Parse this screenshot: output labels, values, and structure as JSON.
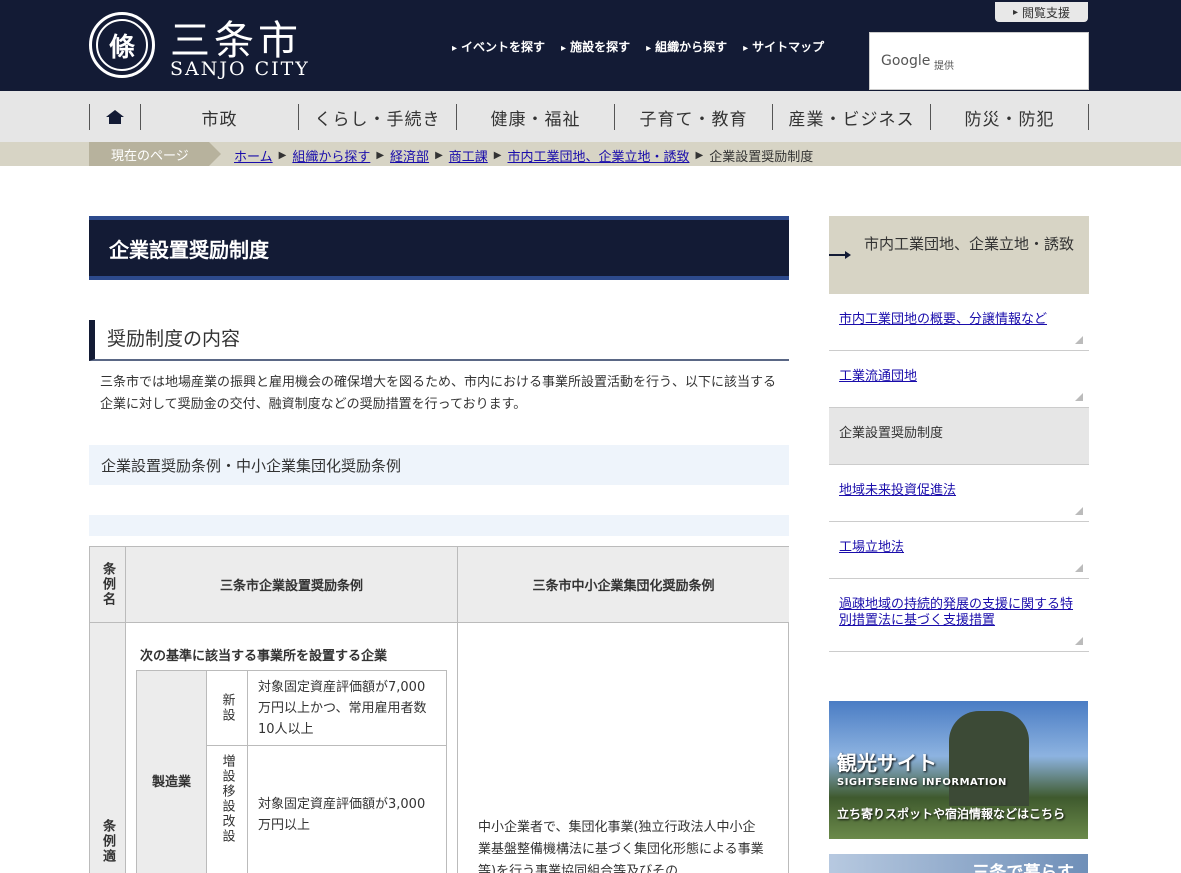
{
  "header": {
    "logo_symbol": "條",
    "logo_jp": "三条市",
    "logo_en": "SANJO CITY",
    "topnav": [
      "イベントを探す",
      "施設を探す",
      "組織から探す",
      "サイトマップ"
    ],
    "access_label": "閲覧支援",
    "search_brand": "Google",
    "search_provided": "提供"
  },
  "mainnav": [
    "市政",
    "くらし・手続き",
    "健康・福祉",
    "子育て・教育",
    "産業・ビジネス",
    "防災・防犯"
  ],
  "breadcrumb": {
    "label": "現在のページ",
    "links": [
      "ホーム",
      "組織から探す",
      "経済部",
      "商工課",
      "市内工業団地、企業立地・誘致"
    ],
    "current": "企業設置奨励制度"
  },
  "page_title": "企業設置奨励制度",
  "section": {
    "h2": "奨励制度の内容",
    "intro": "三条市では地場産業の振興と雇用機会の確保増大を図るため、市内における事業所設置活動を行う、以下に該当する企業に対して奨励金の交付、融資制度などの奨励措置を行っております。",
    "h3": "企業設置奨励条例・中小企業集団化奨励条例"
  },
  "table": {
    "head_row": "条例名",
    "col1": "三条市企業設置奨励条例",
    "col2": "三条市中小企業集団化奨励条例",
    "row2_head": "条例適",
    "criteria_title": "次の基準に該当する事業所を設置する企業",
    "industry": "製造業",
    "new_label": "新設",
    "new_text": "対象固定資産評価額が7,000万円以上かつ、常用雇用者数10人以上",
    "expand_label": "増設移設改設",
    "expand_text": "対象固定資産評価額が3,000万円以上",
    "col2_text": "中小企業者で、集団化事業(独立行政法人中小企業基盤整備機構法に基づく集団化形態による事業等)を行う事業協同組合等及びその"
  },
  "sidebar": {
    "head": "市内工業団地、企業立地・誘致",
    "items": [
      {
        "label": "市内工業団地の概要、分譲情報など",
        "link": true
      },
      {
        "label": "工業流通団地",
        "link": true
      },
      {
        "label": "企業設置奨励制度",
        "link": false
      },
      {
        "label": "地域未来投資促進法",
        "link": true
      },
      {
        "label": "工場立地法",
        "link": true
      },
      {
        "label": "過疎地域の持続的発展の支援に関する特別措置法に基づく支援措置",
        "link": true
      }
    ],
    "banner_title": "観光サイト",
    "banner_sub": "SIGHTSEEING INFORMATION",
    "banner_note": "立ち寄りスポットや宿泊情報などはこちら",
    "banner2_title": "三条で暮らす"
  }
}
